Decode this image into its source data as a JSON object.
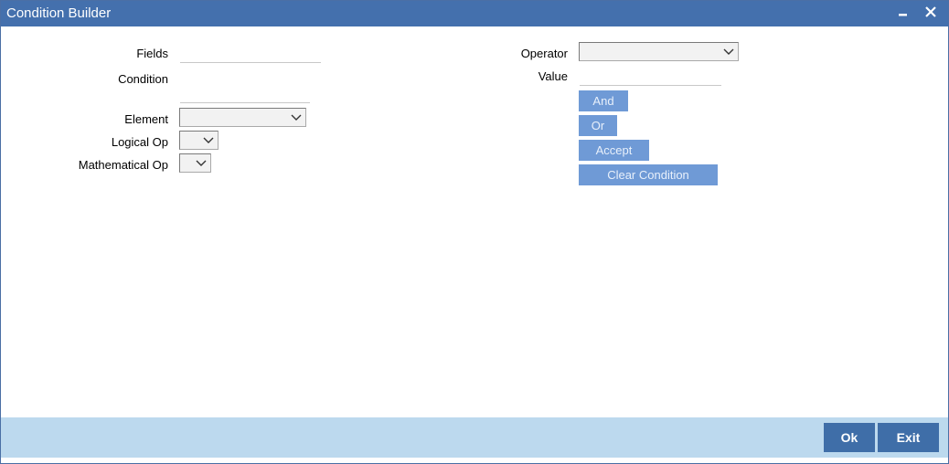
{
  "window": {
    "title": "Condition Builder",
    "minimize_icon": "minimize-icon",
    "close_icon": "close-icon"
  },
  "form": {
    "fields_label": "Fields",
    "fields_value": "",
    "condition_label": "Condition",
    "condition_value": "",
    "element_label": "Element",
    "element_value": "",
    "logical_op_label": "Logical Op",
    "logical_op_value": "",
    "mathematical_op_label": "Mathematical Op",
    "mathematical_op_value": "",
    "operator_label": "Operator",
    "operator_value": "",
    "value_label": "Value",
    "value_value": ""
  },
  "actions": {
    "and_label": "And",
    "or_label": "Or",
    "accept_label": "Accept",
    "clear_condition_label": "Clear Condition"
  },
  "footer": {
    "ok_label": "Ok",
    "exit_label": "Exit"
  },
  "colors": {
    "titlebar": "#4470ad",
    "action_button": "#6f9ad6",
    "footer_bg": "#bcd9ee",
    "footer_button": "#3f6ea8"
  }
}
